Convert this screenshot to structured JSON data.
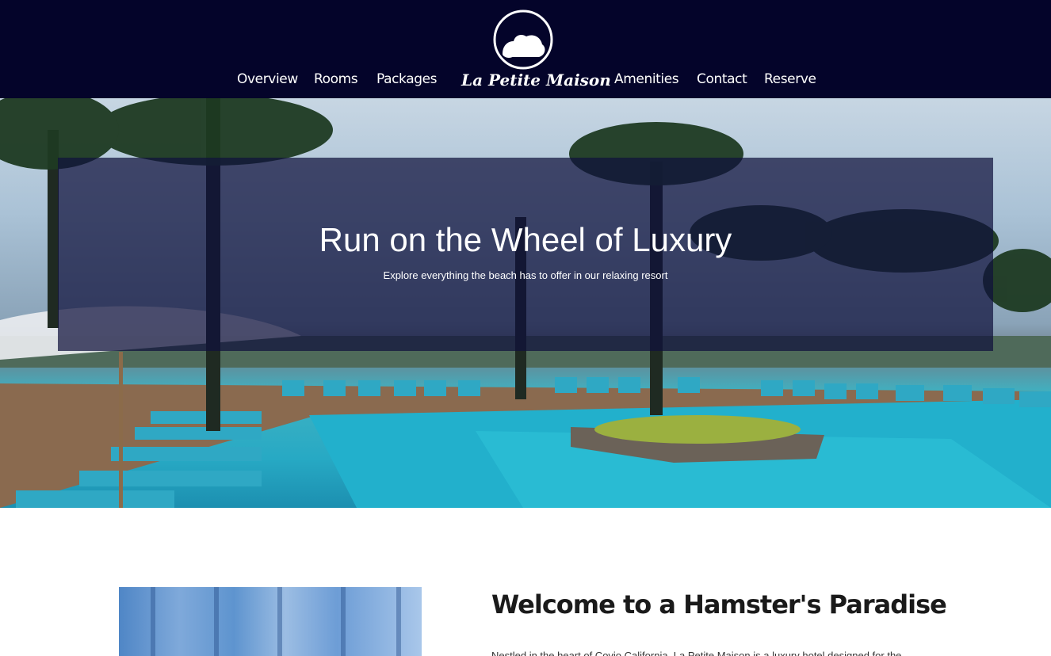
{
  "header": {
    "logo_text": "La Petite Maison",
    "nav_left": [
      "Overview",
      "Rooms",
      "Packages"
    ],
    "nav_right": [
      "Amenities",
      "Contact",
      "Reserve"
    ]
  },
  "hero": {
    "title": "Run on the Wheel of Luxury",
    "subtitle": "Explore everything the beach has to offer in our relaxing resort"
  },
  "welcome": {
    "title": "Welcome to a Hamster's Paradise",
    "body": "Nestled in the heart of Covio California, La Petite Maison is a luxury hotel designed for the"
  },
  "colors": {
    "header_bg": "#04042a",
    "hero_overlay": "#0f103c",
    "text_dark": "#1a1a1a"
  }
}
